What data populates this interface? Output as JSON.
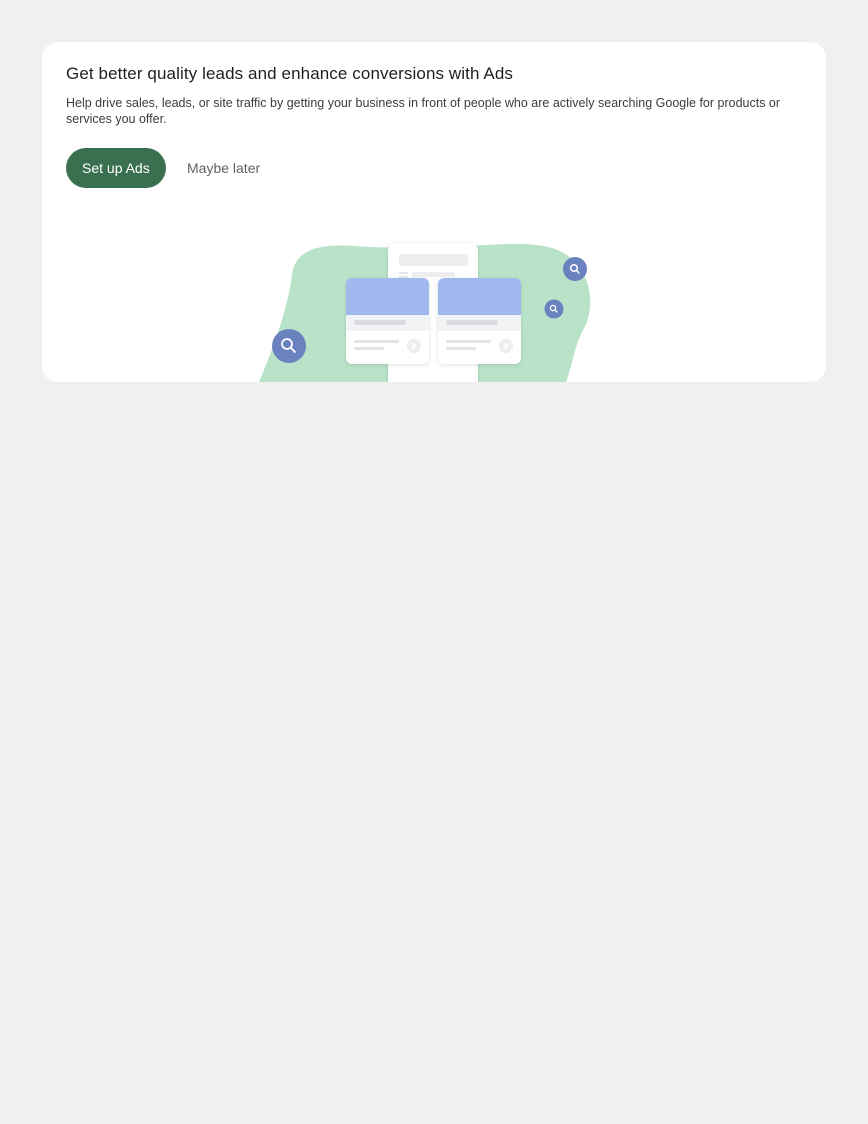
{
  "promo": {
    "title": "Get better quality leads and enhance conversions with Ads",
    "description": "Help drive sales, leads, or site traffic by getting your business in front of people who are actively searching Google for products or services you offer.",
    "primary_button_label": "Set up Ads",
    "secondary_button_label": "Maybe later"
  },
  "colors": {
    "page_background": "#f0f0f0",
    "card_background": "#ffffff",
    "primary_button": "#3a7050",
    "blob": "#b8e3c9",
    "card_header": "#a0b8ee",
    "search_badge": "#6a82c0"
  },
  "icons": {
    "search_badges": [
      "search-icon",
      "search-icon",
      "search-icon"
    ],
    "card_arrow": "chevron-right-icon"
  }
}
